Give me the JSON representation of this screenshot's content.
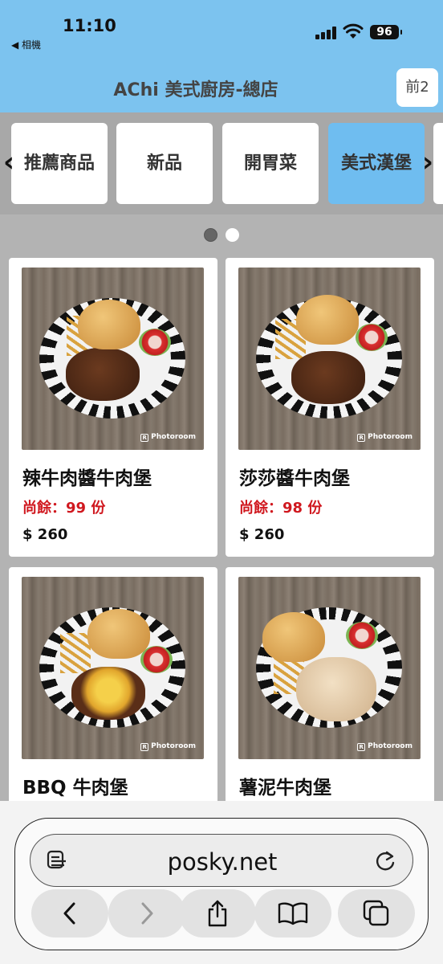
{
  "status": {
    "time": "11:10",
    "back_app": "◀ 相機",
    "battery": "96"
  },
  "header": {
    "store_name": "AChi 美式廚房-總店",
    "table_label": "前2"
  },
  "categories": [
    {
      "label": "推薦商品",
      "active": false
    },
    {
      "label": "新品",
      "active": false
    },
    {
      "label": "開胃菜",
      "active": false
    },
    {
      "label": "美式漢堡",
      "active": true
    }
  ],
  "nav_arrows": {
    "prev": "‹",
    "next": "›"
  },
  "pager": {
    "pages": 2,
    "current": 1
  },
  "products": [
    {
      "name": "辣牛肉醬牛肉堡",
      "stock": "尚餘：99 份",
      "price": "$ 260",
      "watermark": "Photoroom"
    },
    {
      "name": "莎莎醬牛肉堡",
      "stock": "尚餘：98 份",
      "price": "$ 260",
      "watermark": "Photoroom"
    },
    {
      "name": "BBQ 牛肉堡",
      "stock": "",
      "price": "",
      "watermark": "Photoroom"
    },
    {
      "name": "薯泥牛肉堡",
      "stock": "",
      "price": "",
      "watermark": "Photoroom"
    }
  ],
  "browser": {
    "url": "posky.net"
  },
  "colors": {
    "header_bg": "#7cc3ef",
    "active_tab": "#6fbdf0",
    "stock_red": "#d0181f"
  }
}
